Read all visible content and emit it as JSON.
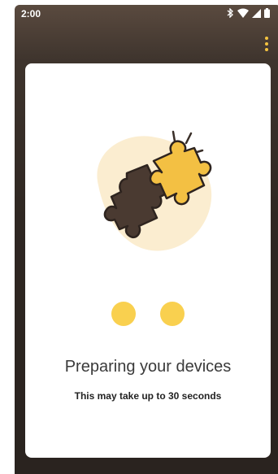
{
  "status_bar": {
    "time": "2:00",
    "icons": [
      "bluetooth-icon",
      "wifi-icon",
      "cell-signal-icon",
      "battery-icon"
    ]
  },
  "app_bar": {
    "menu_icon": "more-vert-icon"
  },
  "card": {
    "illustration": "puzzle-pieces-icon",
    "title": "Preparing your devices",
    "subtitle": "This may take up to 30 seconds",
    "loading_dots": 2
  },
  "colors": {
    "accent": "#f9d04f",
    "puzzle_light": "#f3c043",
    "puzzle_dark": "#4a3a31",
    "blob": "#fbedd0",
    "background_dark": "#2f2722"
  }
}
